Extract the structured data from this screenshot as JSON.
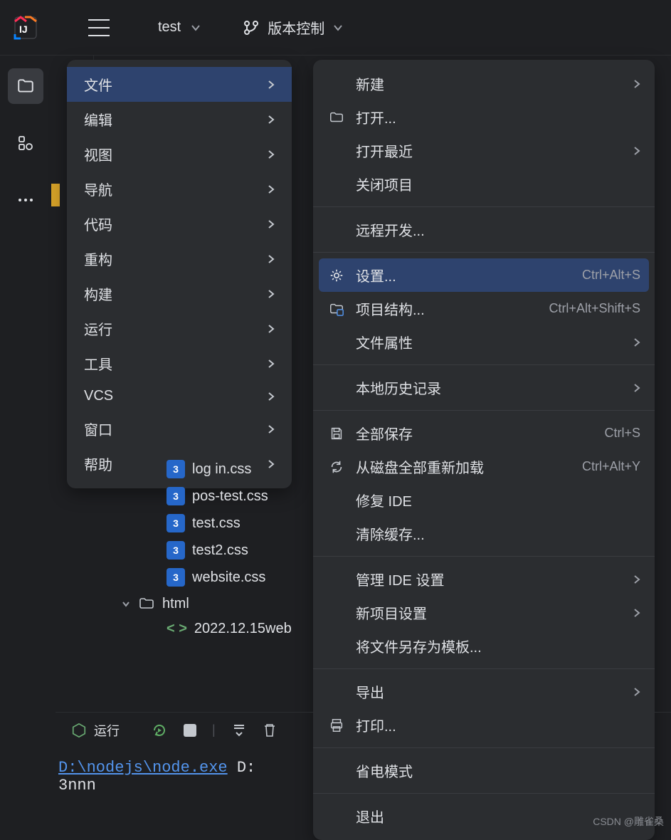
{
  "topbar": {
    "project_name": "test",
    "vcs_label": "版本控制"
  },
  "main_menu": [
    {
      "label": "文件",
      "selected": true
    },
    {
      "label": "编辑"
    },
    {
      "label": "视图"
    },
    {
      "label": "导航"
    },
    {
      "label": "代码"
    },
    {
      "label": "重构"
    },
    {
      "label": "构建"
    },
    {
      "label": "运行"
    },
    {
      "label": "工具"
    },
    {
      "label": "VCS"
    },
    {
      "label": "窗口"
    },
    {
      "label": "帮助"
    }
  ],
  "file_menu": {
    "groups": [
      [
        {
          "label": "新建",
          "arrow": true
        },
        {
          "label": "打开...",
          "icon": "folder"
        },
        {
          "label": "打开最近",
          "arrow": true
        },
        {
          "label": "关闭项目"
        }
      ],
      [
        {
          "label": "远程开发..."
        }
      ],
      [
        {
          "label": "设置...",
          "icon": "gear",
          "shortcut": "Ctrl+Alt+S",
          "selected": true
        },
        {
          "label": "项目结构...",
          "icon": "proj-struct",
          "shortcut": "Ctrl+Alt+Shift+S"
        },
        {
          "label": "文件属性",
          "arrow": true
        }
      ],
      [
        {
          "label": "本地历史记录",
          "arrow": true
        }
      ],
      [
        {
          "label": "全部保存",
          "icon": "save",
          "shortcut": "Ctrl+S"
        },
        {
          "label": "从磁盘全部重新加载",
          "icon": "reload",
          "shortcut": "Ctrl+Alt+Y"
        },
        {
          "label": "修复 IDE"
        },
        {
          "label": "清除缓存..."
        }
      ],
      [
        {
          "label": "管理 IDE 设置",
          "arrow": true
        },
        {
          "label": "新项目设置",
          "arrow": true
        },
        {
          "label": "将文件另存为模板..."
        }
      ],
      [
        {
          "label": "导出",
          "arrow": true
        },
        {
          "label": "打印...",
          "icon": "print"
        }
      ],
      [
        {
          "label": "省电模式"
        }
      ],
      [
        {
          "label": "退出"
        }
      ]
    ]
  },
  "tree": {
    "css_files": [
      "log in.css",
      "pos-test.css",
      "test.css",
      "test2.css",
      "website.css"
    ],
    "folder": "html",
    "html_file": "2022.12.15web"
  },
  "run": {
    "label": "运行"
  },
  "terminal": {
    "exe_path": "D:\\nodejs\\node.exe",
    "tail": "D:",
    "output": "3nnn"
  },
  "watermark": "CSDN @雕雀桑"
}
